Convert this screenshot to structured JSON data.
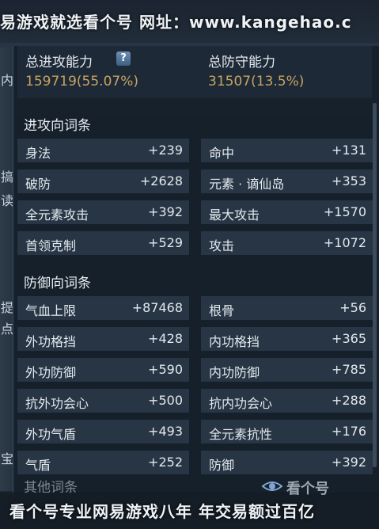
{
  "watermark": {
    "top": "易游戏就选看个号  网址：www.kangehao.c",
    "bottom": "看个号专业网易游戏八年  年交易额过百亿",
    "logo": "看个号"
  },
  "sidebar": {
    "chars": [
      "内",
      "搞",
      "读",
      "提",
      "点",
      "宝"
    ]
  },
  "summary": {
    "attack_label": "总进攻能力",
    "attack_value": "159719(55.07%)",
    "defense_label": "总防守能力",
    "defense_value": "31507(13.5%)",
    "help_icon": "?"
  },
  "sections": {
    "attack": "进攻向词条",
    "defense": "防御向词条",
    "other": "其他词条"
  },
  "attack_stats": [
    {
      "name": "身法",
      "value": "+239"
    },
    {
      "name": "命中",
      "value": "+131"
    },
    {
      "name": "破防",
      "value": "+2628"
    },
    {
      "name": "元素 · 谪仙岛",
      "value": "+353"
    },
    {
      "name": "全元素攻击",
      "value": "+392"
    },
    {
      "name": "最大攻击",
      "value": "+1570"
    },
    {
      "name": "首领克制",
      "value": "+529"
    },
    {
      "name": "攻击",
      "value": "+1072"
    }
  ],
  "defense_stats": [
    {
      "name": "气血上限",
      "value": "+87468"
    },
    {
      "name": "根骨",
      "value": "+56"
    },
    {
      "name": "外功格挡",
      "value": "+428"
    },
    {
      "name": "内功格挡",
      "value": "+365"
    },
    {
      "name": "外功防御",
      "value": "+590"
    },
    {
      "name": "内功防御",
      "value": "+785"
    },
    {
      "name": "抗外功会心",
      "value": "+500"
    },
    {
      "name": "抗内功会心",
      "value": "+288"
    },
    {
      "name": "外功气盾",
      "value": "+493"
    },
    {
      "name": "全元素抗性",
      "value": "+176"
    },
    {
      "name": "气盾",
      "value": "+252"
    },
    {
      "name": "防御",
      "value": "+392"
    }
  ],
  "colors": {
    "accent": "#c7a462",
    "cell": "#273544",
    "text": "#e3e9ef"
  }
}
